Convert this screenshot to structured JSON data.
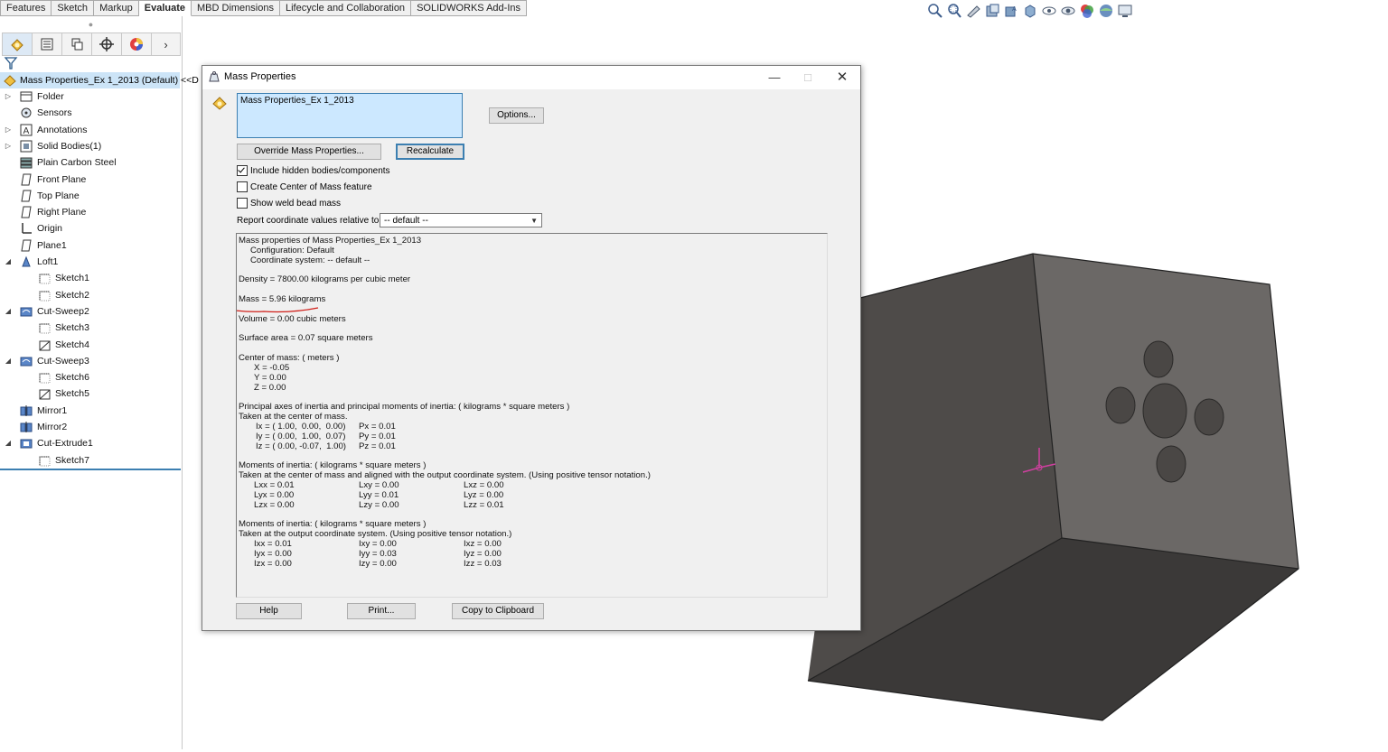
{
  "ribbon": {
    "tabs": [
      "Features",
      "Sketch",
      "Markup",
      "Evaluate",
      "MBD Dimensions",
      "Lifecycle and Collaboration",
      "SOLIDWORKS Add-Ins"
    ],
    "active_tab": "Evaluate"
  },
  "feature_tree": {
    "root": "Mass Properties_Ex 1_2013 (Default) <<D",
    "items": [
      {
        "label": "Folder",
        "icon": "folder-icon",
        "level": 1,
        "expand": "closed"
      },
      {
        "label": "Sensors",
        "icon": "sensor-icon",
        "level": 1,
        "expand": "none"
      },
      {
        "label": "Annotations",
        "icon": "annotation-icon",
        "level": 1,
        "expand": "closed"
      },
      {
        "label": "Solid Bodies(1)",
        "icon": "solid-bodies-icon",
        "level": 1,
        "expand": "closed"
      },
      {
        "label": "Plain Carbon Steel",
        "icon": "material-icon",
        "level": 1,
        "expand": "none"
      },
      {
        "label": "Front Plane",
        "icon": "plane-icon",
        "level": 1,
        "expand": "none"
      },
      {
        "label": "Top Plane",
        "icon": "plane-icon",
        "level": 1,
        "expand": "none"
      },
      {
        "label": "Right Plane",
        "icon": "plane-icon",
        "level": 1,
        "expand": "none"
      },
      {
        "label": "Origin",
        "icon": "origin-icon",
        "level": 1,
        "expand": "none"
      },
      {
        "label": "Plane1",
        "icon": "plane-icon",
        "level": 1,
        "expand": "none"
      },
      {
        "label": "Loft1",
        "icon": "loft-icon",
        "level": 1,
        "expand": "open"
      },
      {
        "label": "Sketch1",
        "icon": "sketch-icon",
        "level": 2,
        "expand": "none"
      },
      {
        "label": "Sketch2",
        "icon": "sketch-icon",
        "level": 2,
        "expand": "none"
      },
      {
        "label": "Cut-Sweep2",
        "icon": "cut-sweep-icon",
        "level": 1,
        "expand": "open"
      },
      {
        "label": "Sketch3",
        "icon": "sketch-icon",
        "level": 2,
        "expand": "none"
      },
      {
        "label": "Sketch4",
        "icon": "sketch-3d-icon",
        "level": 2,
        "expand": "none"
      },
      {
        "label": "Cut-Sweep3",
        "icon": "cut-sweep-icon",
        "level": 1,
        "expand": "open"
      },
      {
        "label": "Sketch6",
        "icon": "sketch-icon",
        "level": 2,
        "expand": "none"
      },
      {
        "label": "Sketch5",
        "icon": "sketch-3d-icon",
        "level": 2,
        "expand": "none"
      },
      {
        "label": "Mirror1",
        "icon": "mirror-icon",
        "level": 1,
        "expand": "none"
      },
      {
        "label": "Mirror2",
        "icon": "mirror-icon",
        "level": 1,
        "expand": "none"
      },
      {
        "label": "Cut-Extrude1",
        "icon": "cut-extrude-icon",
        "level": 1,
        "expand": "open"
      },
      {
        "label": "Sketch7",
        "icon": "sketch-icon",
        "level": 2,
        "expand": "none"
      }
    ]
  },
  "dialog": {
    "title": "Mass Properties",
    "selected_item": "Mass Properties_Ex 1_2013",
    "options_button": "Options...",
    "override_button": "Override Mass Properties...",
    "recalculate_button": "Recalculate",
    "checkboxes": [
      {
        "label": "Include hidden bodies/components",
        "checked": true
      },
      {
        "label": "Create Center of Mass feature",
        "checked": false
      },
      {
        "label": "Show weld bead mass",
        "checked": false
      }
    ],
    "coord_label": "Report coordinate values relative to:",
    "coord_value": "-- default --",
    "results": {
      "header": "Mass properties of Mass Properties_Ex 1_2013",
      "configuration": "Configuration: Default",
      "coordinate_system": "Coordinate system: -- default --",
      "density": "Density = 7800.00 kilograms per cubic meter",
      "mass": "Mass = 5.96 kilograms",
      "volume": "Volume = 0.00 cubic meters",
      "surface_area": "Surface area = 0.07 square meters",
      "com_title": "Center of mass: ( meters )",
      "com_x": "X = -0.05",
      "com_y": "Y = 0.00",
      "com_z": "Z = 0.00",
      "principal_title": "Principal axes of inertia and principal moments of inertia: ( kilograms * square meters )",
      "principal_sub": "Taken at the center of mass.",
      "principal_rows": [
        {
          "axis": "Ix = ( 1.00,  0.00,  0.00)",
          "moment": "Px = 0.01"
        },
        {
          "axis": "Iy = ( 0.00,  1.00,  0.07)",
          "moment": "Py = 0.01"
        },
        {
          "axis": "Iz = ( 0.00, -0.07,  1.00)",
          "moment": "Pz = 0.01"
        }
      ],
      "moi_com_title": "Moments of inertia: ( kilograms * square meters )",
      "moi_com_sub": "Taken at the center of mass and aligned with the output coordinate system. (Using positive tensor notation.)",
      "moi_com_rows": [
        [
          "Lxx = 0.01",
          "Lxy = 0.00",
          "Lxz = 0.00"
        ],
        [
          "Lyx = 0.00",
          "Lyy = 0.01",
          "Lyz = 0.00"
        ],
        [
          "Lzx = 0.00",
          "Lzy = 0.00",
          "Lzz = 0.01"
        ]
      ],
      "moi_out_title": "Moments of inertia: ( kilograms * square meters )",
      "moi_out_sub": "Taken at the output coordinate system. (Using positive tensor notation.)",
      "moi_out_rows": [
        [
          "Ixx = 0.01",
          "Ixy = 0.00",
          "Ixz = 0.00"
        ],
        [
          "Iyx = 0.00",
          "Iyy = 0.03",
          "Iyz = 0.00"
        ],
        [
          "Izx = 0.00",
          "Izy = 0.00",
          "Izz = 0.03"
        ]
      ]
    },
    "help_button": "Help",
    "print_button": "Print...",
    "copy_button": "Copy to Clipboard"
  },
  "colors": {
    "accent": "#3c7fb1",
    "selection": "#cce8ff",
    "annotation_underline": "#d0201a",
    "model_front": "#4f4c4a",
    "model_side": "#6a6765",
    "model_bottom": "#3a3837"
  }
}
